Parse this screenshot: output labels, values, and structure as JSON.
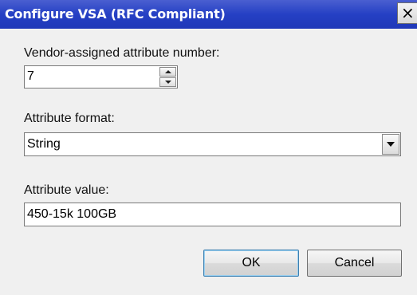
{
  "window": {
    "title": "Configure VSA (RFC Compliant)",
    "close_glyph": "×"
  },
  "vendor_attribute": {
    "label": "Vendor-assigned attribute number:",
    "value": "7"
  },
  "attribute_format": {
    "label": "Attribute format:",
    "selected": "String"
  },
  "attribute_value": {
    "label": "Attribute value:",
    "value": "450-15k 100GB"
  },
  "buttons": {
    "ok": "OK",
    "cancel": "Cancel"
  },
  "colors": {
    "titlebar": "#2540c4",
    "background": "#f0f0f0"
  }
}
